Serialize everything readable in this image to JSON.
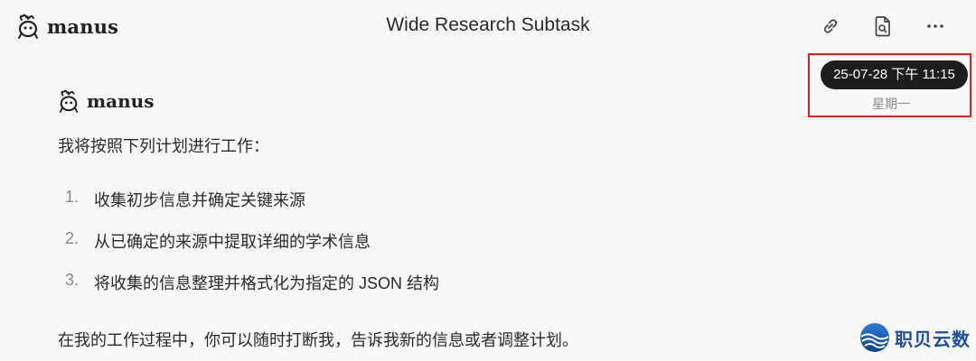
{
  "header": {
    "brand": "manus",
    "title": "Wide Research Subtask",
    "icons": [
      "link-icon",
      "document-search-icon",
      "more-icon"
    ]
  },
  "timestamp": {
    "datetime": "25-07-28 下午 11:15",
    "weekday": "星期一"
  },
  "message": {
    "sender": "manus",
    "intro": "我将按照下列计划进行工作：",
    "steps": [
      {
        "num": "1.",
        "text": "收集初步信息并确定关键来源"
      },
      {
        "num": "2.",
        "text": "从已确定的来源中提取详细的学术信息"
      },
      {
        "num": "3.",
        "text": "将收集的信息整理并格式化为指定的 JSON 结构"
      }
    ],
    "outro": "在我的工作过程中，你可以随时打断我，告诉我新的信息或者调整计划。"
  },
  "watermark": {
    "text": "职贝云数"
  },
  "colors": {
    "background": "#f8f8f7",
    "highlight_border": "#e02020",
    "pill_background": "#1d1d1d",
    "watermark_blue": "#1d4fa0"
  }
}
